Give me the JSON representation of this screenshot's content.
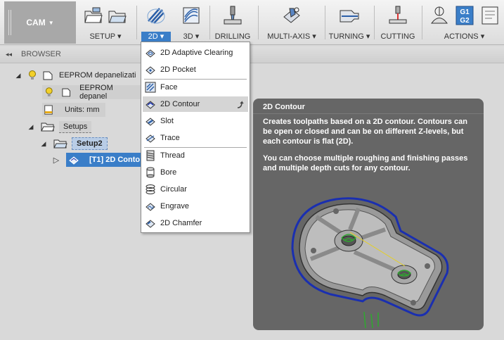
{
  "toolbar": {
    "workspace": "CAM",
    "groups": [
      {
        "label": "SETUP ▾"
      },
      {
        "label": "2D ▾"
      },
      {
        "label": "3D ▾"
      },
      {
        "label": "DRILLING"
      },
      {
        "label": "MULTI-AXIS ▾"
      },
      {
        "label": "TURNING ▾"
      },
      {
        "label": "CUTTING"
      },
      {
        "label": "ACTIONS ▾"
      }
    ],
    "g_code_icon_text": [
      "G1",
      "G2"
    ]
  },
  "browser": {
    "title": "BROWSER",
    "collapse": "◂◂",
    "nodes": [
      {
        "label": "EEPROM depanelizati"
      },
      {
        "label": "EEPROM depanel"
      },
      {
        "label": "Units: mm"
      },
      {
        "label": "Setups"
      },
      {
        "label": "Setup2"
      },
      {
        "label": "[T1] 2D Conto"
      }
    ]
  },
  "menu": {
    "items": [
      {
        "label": "2D Adaptive Clearing"
      },
      {
        "label": "2D Pocket"
      },
      {
        "label": "Face"
      },
      {
        "label": "2D Contour"
      },
      {
        "label": "Slot"
      },
      {
        "label": "Trace"
      },
      {
        "label": "Thread"
      },
      {
        "label": "Bore"
      },
      {
        "label": "Circular"
      },
      {
        "label": "Engrave"
      },
      {
        "label": "2D Chamfer"
      }
    ]
  },
  "tooltip": {
    "title": "2D Contour",
    "p1": "Creates toolpaths based on a 2D contour. Contours can be open or closed and can be on different Z-levels, but each contour is flat (2D).",
    "p2": "You can choose multiple roughing and finishing passes and multiple depth cuts for any contour."
  },
  "colors": {
    "accent": "#3a7ec8",
    "tooltip_bg": "#666666",
    "toolpath": "#1a2fb0",
    "toolpath_green": "#2fa82f"
  }
}
